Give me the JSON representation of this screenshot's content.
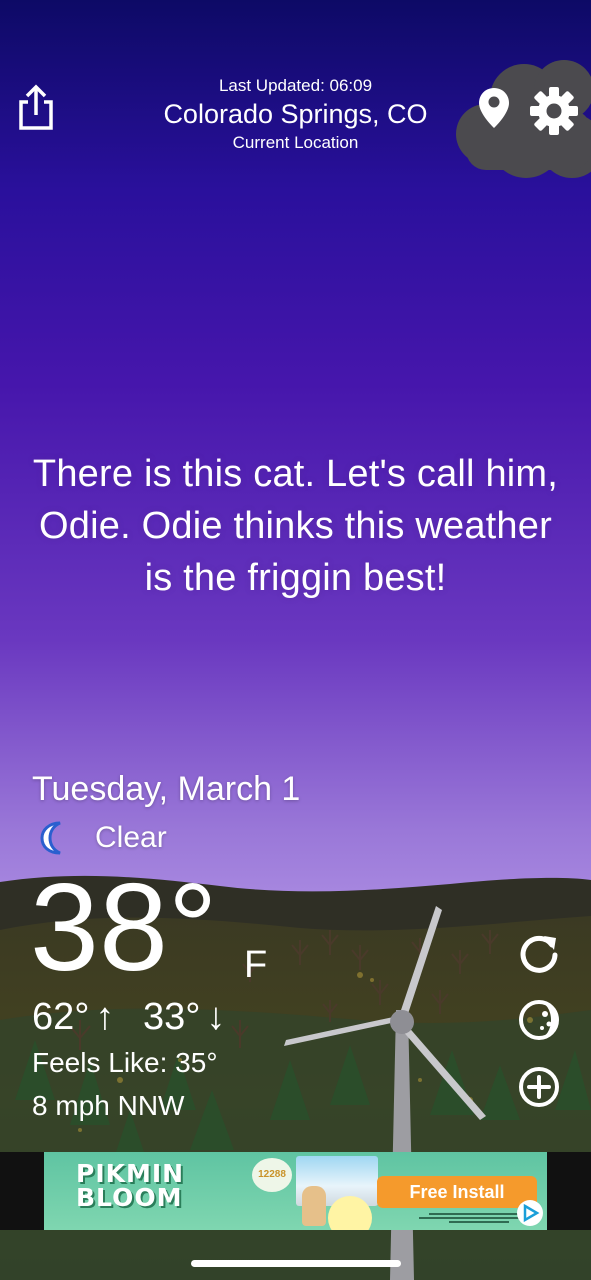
{
  "header": {
    "last_updated": "Last Updated: 06:09",
    "city": "Colorado Springs, CO",
    "location_mode": "Current Location"
  },
  "quip": "There is this cat. Let's call him, Odie. Odie thinks this weather is the friggin best!",
  "weather": {
    "date": "Tuesday, March 1",
    "condition": "Clear",
    "temperature": "38°",
    "unit": "F",
    "high": "62°",
    "high_arrow": "↑",
    "low": "33°",
    "low_arrow": "↓",
    "feels_like": "Feels Like: 35°",
    "wind": "8 mph NNW"
  },
  "ad": {
    "brand_line1": "PIKMIN",
    "brand_line2": "BLOOM",
    "cta": "Free Install",
    "badge": "12288"
  },
  "icons": [
    "share-icon",
    "location-pin-icon",
    "gear-icon",
    "moon-icon",
    "refresh-icon",
    "moon-phase-icon",
    "add-circle-icon",
    "adchoices-icon"
  ],
  "colors": {
    "sky_top": "#0d0a66",
    "sky_bottom": "#c9b0f2",
    "ad_cta": "#f59a2c",
    "hills": "#3e3a22"
  }
}
